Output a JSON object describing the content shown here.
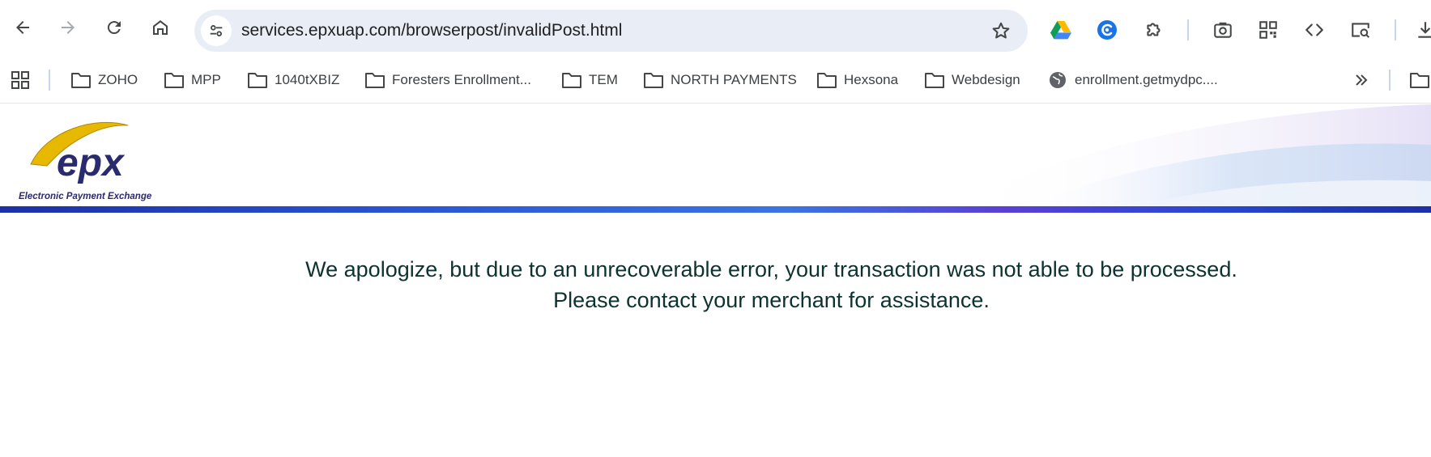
{
  "browser": {
    "nav": {
      "back_icon": "arrow-left-icon",
      "forward_icon": "arrow-right-icon",
      "reload_icon": "reload-icon",
      "home_icon": "home-icon"
    },
    "omnibox": {
      "url": "services.epxuap.com/browserpost/invalidPost.html",
      "site_info_icon": "tune-icon",
      "bookmark_icon": "star-icon"
    },
    "extensions": [
      "google-drive-icon",
      "grammar-extension-icon",
      "puzzle-icon",
      "screenshot-icon",
      "qr-code-icon",
      "code-icon",
      "search-page-icon",
      "download-icon"
    ]
  },
  "bookmarks_bar": {
    "apps_icon": "apps-grid-icon",
    "items": [
      {
        "label": "ZOHO",
        "icon": "folder-icon"
      },
      {
        "label": "MPP",
        "icon": "folder-icon"
      },
      {
        "label": "1040tXBIZ",
        "icon": "folder-icon"
      },
      {
        "label": "Foresters Enrollment...",
        "icon": "folder-icon"
      },
      {
        "label": "TEM",
        "icon": "folder-icon"
      },
      {
        "label": "NORTH PAYMENTS",
        "icon": "folder-icon"
      },
      {
        "label": "Hexsona",
        "icon": "folder-icon"
      },
      {
        "label": "Webdesign",
        "icon": "folder-icon"
      },
      {
        "label": "enrollment.getmydpc....",
        "icon": "globe-icon"
      }
    ],
    "overflow_icon": "chevron-double-right-icon"
  },
  "page": {
    "logo": {
      "wordmark": "epx",
      "tagline": "Electronic Payment Exchange"
    },
    "message_line1": "We apologize, but due to an unrecoverable error, your transaction was not able to be processed.",
    "message_line2": "Please contact your merchant for assistance."
  },
  "colors": {
    "omnibox_bg": "#e9eef6",
    "message_text": "#0d3330",
    "rule_blue": "#2b57d6",
    "logo_navy": "#2a2a6e",
    "logo_gold": "#e6b800"
  }
}
